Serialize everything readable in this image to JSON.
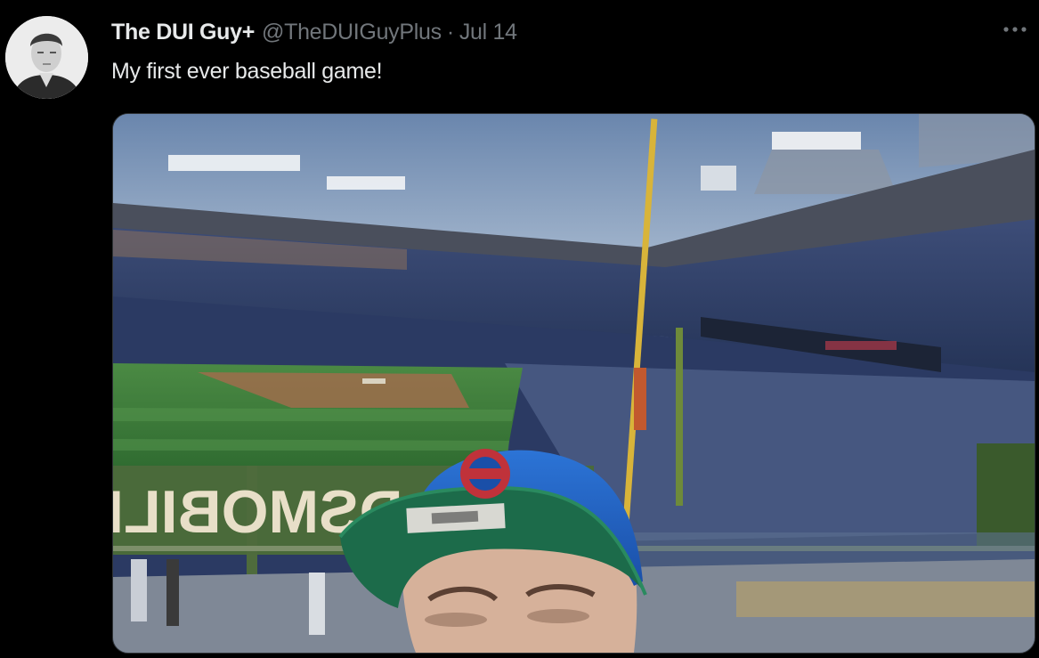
{
  "tweet": {
    "author": {
      "display_name": "The DUI Guy+",
      "handle": "@TheDUIGuyPlus",
      "avatar_icon": "profile-photo"
    },
    "separator": "·",
    "timestamp": "Jul 14",
    "text": "My first ever baseball game!",
    "more_icon": "more-horizontal-icon",
    "media": {
      "type": "photo",
      "sign_text": "OLDSMOBILE"
    }
  },
  "colors": {
    "background": "#000000",
    "primary_text": "#e7e9ea",
    "secondary_text": "#71767b",
    "cap_blue": "#1d5fc2",
    "cap_brim": "#1c6b4a",
    "field_green": "#3f7a3a"
  }
}
